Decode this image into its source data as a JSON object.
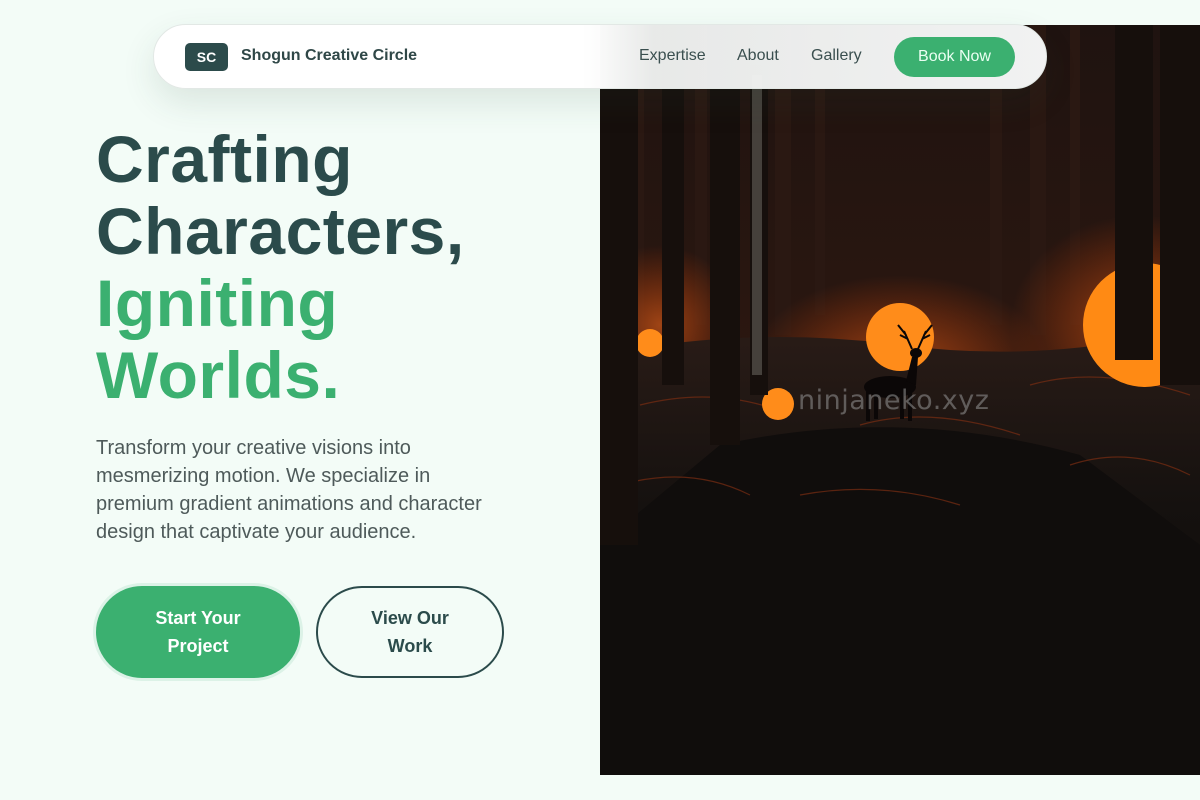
{
  "nav": {
    "logo_text": "SC",
    "brand": "Shogun Creative Circle",
    "links": [
      "Expertise",
      "About",
      "Gallery"
    ],
    "cta": "Book Now"
  },
  "hero": {
    "headline_line1": "Crafting",
    "headline_line2": "Characters,",
    "headline_line3": "Igniting",
    "headline_line4": "Worlds.",
    "description": "Transform your creative visions into mesmerizing motion. We specialize in premium gradient animations and character design that captivate your audience.",
    "primary_button": "Start Your Project",
    "secondary_button": "View Our Work",
    "image_watermark": "ninjaneko.xyz"
  },
  "colors": {
    "background": "#f3fcf7",
    "accent_green": "#3bb070",
    "dark_teal": "#2b4b4b"
  }
}
